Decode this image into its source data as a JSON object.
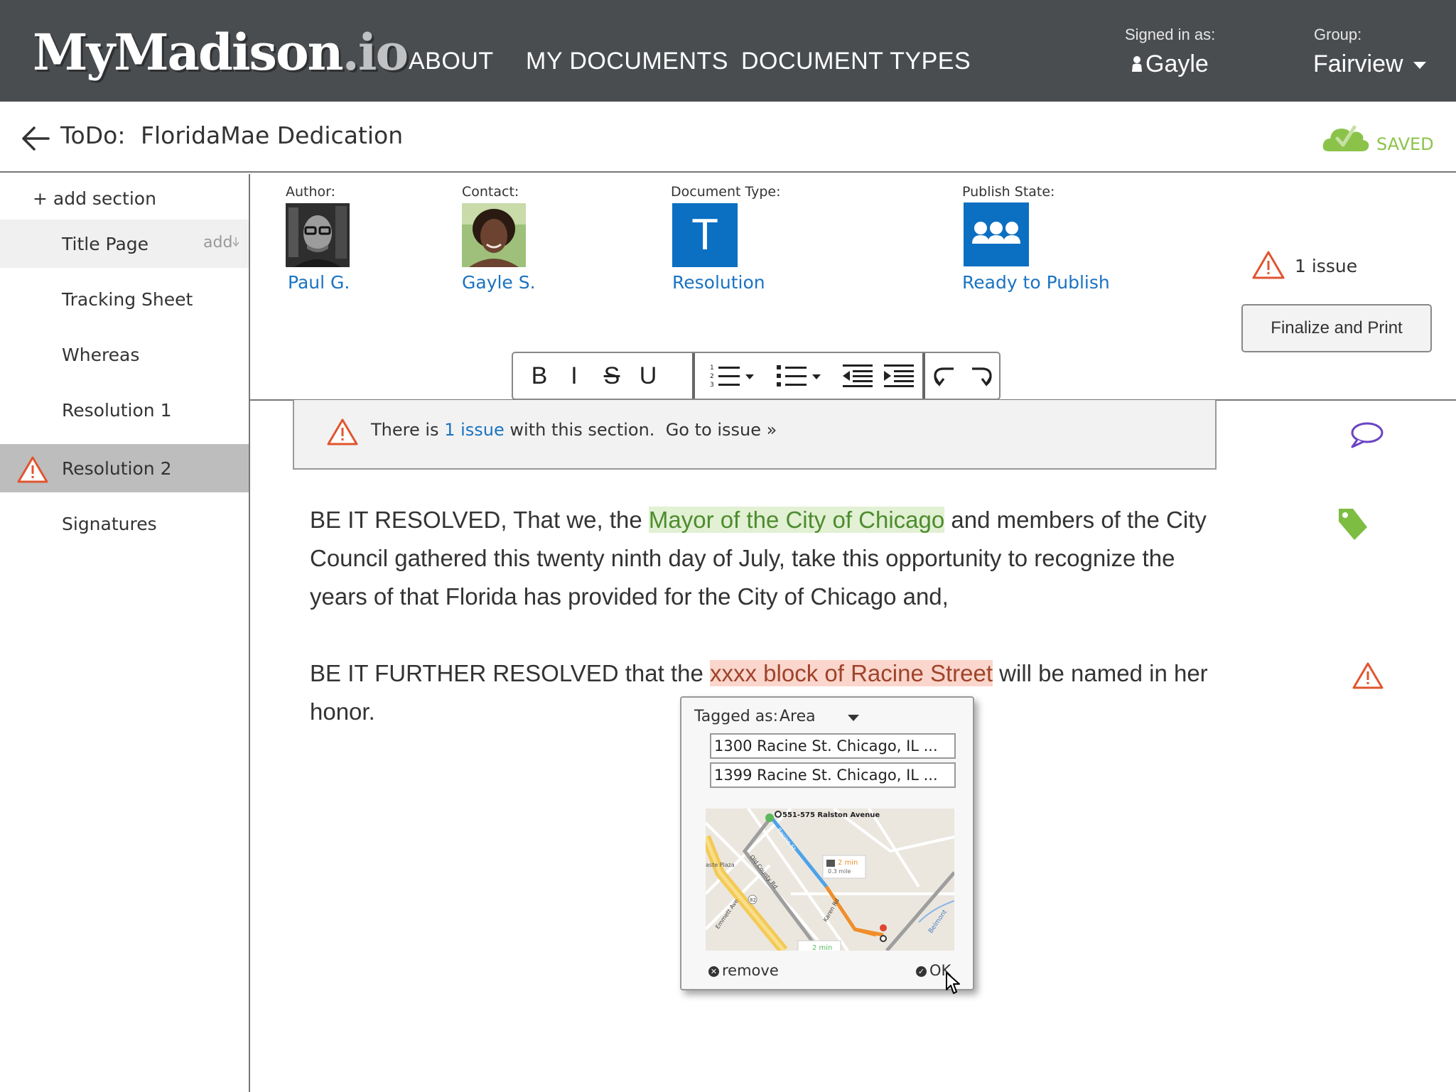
{
  "app": {
    "logo_main": "MyMadison",
    "logo_suffix": ".io"
  },
  "nav": {
    "items": [
      "ABOUT",
      "MY DOCUMENTS",
      "DOCUMENT TYPES"
    ],
    "signed_in_label": "Signed in as:",
    "signed_in_user": "Gayle",
    "group_label": "Group:",
    "group_value": "Fairview"
  },
  "title_bar": {
    "label": "ToDo:",
    "document_name": "FloridaMae Dedication",
    "save_status": "SAVED"
  },
  "sidebar": {
    "add_section": "+ add section",
    "add_hint": "add",
    "items": [
      {
        "label": "Title Page"
      },
      {
        "label": "Tracking Sheet"
      },
      {
        "label": "Whereas"
      },
      {
        "label": "Resolution 1"
      },
      {
        "label": "Resolution 2"
      },
      {
        "label": "Signatures"
      }
    ]
  },
  "meta": {
    "author_label": "Author:",
    "author_name": "Paul G.",
    "contact_label": "Contact:",
    "contact_name": "Gayle S.",
    "doctype_label": "Document Type:",
    "doctype_letter": "T",
    "doctype_name": "Resolution",
    "publish_label": "Publish State:",
    "publish_state": "Ready to Publish",
    "issue_count": "1 issue",
    "finalize_button": "Finalize and Print"
  },
  "toolbar": {
    "bold": "B",
    "italic": "I",
    "strike": "S",
    "underline": "U"
  },
  "issue_banner": {
    "prefix": "There is",
    "count_link": "1 issue",
    "suffix": "with this section.",
    "goto": "Go to issue",
    "goto_glyph": "»"
  },
  "content": {
    "para1_before": "BE IT RESOLVED, That we, the ",
    "para1_highlight": "Mayor of the City of Chicago",
    "para1_after": " and members of the City Council gathered this twenty ninth day of July, take this opportunity to recognize the years of that Florida has provided for the City of Chicago and,",
    "para2_before": "BE IT FURTHER RESOLVED that the ",
    "para2_highlight": "xxxx block of Racine Street",
    "para2_after": " will be named in her honor."
  },
  "tag_popup": {
    "tagged_label": "Tagged as:",
    "tag_type": "Area",
    "address_from": "1300 Racine St. Chicago, IL ...",
    "address_to": "1399 Racine St. Chicago, IL ...",
    "map": {
      "top_address": "551-575 Ralston Avenue",
      "travel_time": "2 min",
      "travel_distance": "0.3 mile",
      "street_a": "Racine St",
      "street_b": "Old County Rd",
      "street_c": "Karen Rd",
      "street_d": "Emmett Ave",
      "street_e": "Belmont",
      "place": "aste Plaza",
      "route_no": "82",
      "travel_time_2": "2 min"
    },
    "remove_label": "remove",
    "ok_label": "OK"
  },
  "colors": {
    "topbar": "#4a4d50",
    "link_blue": "#1a73c2",
    "tile_blue": "#0b6fc2",
    "saved_green": "#8bc34a",
    "warning_red": "#e0552f",
    "comment_purple": "#6a44c4",
    "tag_green": "#7cbd42"
  }
}
